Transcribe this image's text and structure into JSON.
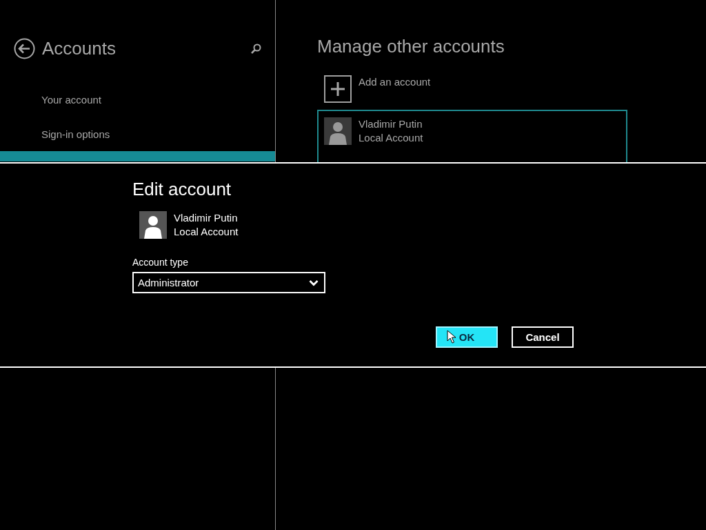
{
  "settings_pane": {
    "title": "Accounts",
    "sidebar": {
      "items": [
        {
          "label": "Your account",
          "selected": false
        },
        {
          "label": "Sign-in options",
          "selected": false
        },
        {
          "selected": true
        }
      ]
    }
  },
  "content": {
    "title": "Manage other accounts",
    "add_account": {
      "label": "Add an account"
    },
    "accounts": [
      {
        "name": "Vladimir Putin",
        "type": "Local Account",
        "selected": true
      }
    ]
  },
  "dialog": {
    "title": "Edit account",
    "account": {
      "name": "Vladimir Putin",
      "type": "Local Account"
    },
    "account_type": {
      "label": "Account type",
      "value": "Administrator"
    },
    "buttons": [
      {
        "label": "OK",
        "kind": "primary"
      },
      {
        "label": "Cancel",
        "kind": "secondary"
      }
    ]
  }
}
